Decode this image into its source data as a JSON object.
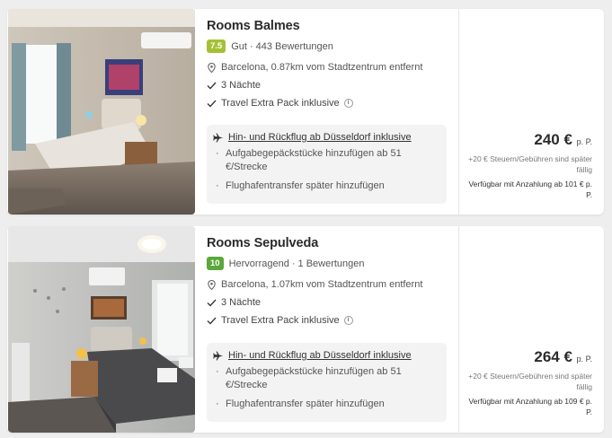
{
  "colors": {
    "badge_good": "#a4c034",
    "badge_excellent": "#5aa83a"
  },
  "results": [
    {
      "name": "Rooms Balmes",
      "score": "7.5",
      "rating_word": "Gut",
      "reviews": "443 Bewertungen",
      "location": "Barcelona, 0.87km vom Stadtzentrum entfernt",
      "nights": "3 Nächte",
      "extra": "Travel Extra Pack inklusive",
      "flight": "Hin- und Rückflug ab Düsseldorf inklusive",
      "baggage": "Aufgabegepäckstücke hinzufügen ab 51 €/Strecke",
      "transfer": "Flughafentransfer später hinzufügen",
      "price": "240 €",
      "per_person": "p. P.",
      "fees": "+20 € Steuern/Gebühren sind später fällig",
      "deposit": "Verfügbar mit Anzahlung ab 101 € p. P."
    },
    {
      "name": "Rooms Sepulveda",
      "score": "10",
      "rating_word": "Hervorragend",
      "reviews": "1 Bewertungen",
      "location": "Barcelona, 1.07km vom Stadtzentrum entfernt",
      "nights": "3 Nächte",
      "extra": "Travel Extra Pack inklusive",
      "flight": "Hin- und Rückflug ab Düsseldorf inklusive",
      "baggage": "Aufgabegepäckstücke hinzufügen ab 51 €/Strecke",
      "transfer": "Flughafentransfer später hinzufügen",
      "price": "264 €",
      "per_person": "p. P.",
      "fees": "+20 € Steuern/Gebühren sind später fällig",
      "deposit": "Verfügbar mit Anzahlung ab 109 € p. P."
    }
  ],
  "icons": {
    "location": "map-pin-icon",
    "check": "check-icon",
    "info": "info-icon",
    "flight": "plane-icon"
  }
}
